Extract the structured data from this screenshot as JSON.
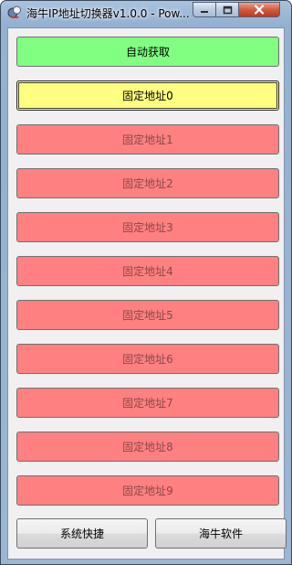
{
  "window": {
    "title": "海牛IP地址切换器v1.0.0 - Pow...",
    "icon": "app-icon",
    "controls": {
      "minimize": "minimize-icon",
      "maximize": "maximize-icon",
      "close": "close-icon"
    }
  },
  "buttons": {
    "auto": "自动获取",
    "address_0": "固定地址0",
    "address_1": "固定地址1",
    "address_2": "固定地址2",
    "address_3": "固定地址3",
    "address_4": "固定地址4",
    "address_5": "固定地址5",
    "address_6": "固定地址6",
    "address_7": "固定地址7",
    "address_8": "固定地址8",
    "address_9": "固定地址9",
    "system_shortcuts": "系统快捷",
    "hainiu_software": "海牛软件"
  },
  "colors": {
    "auto": "#80ff80",
    "active_address": "#ffff80",
    "inactive_address": "#ff8080",
    "inactive_text": "#8a4848"
  }
}
